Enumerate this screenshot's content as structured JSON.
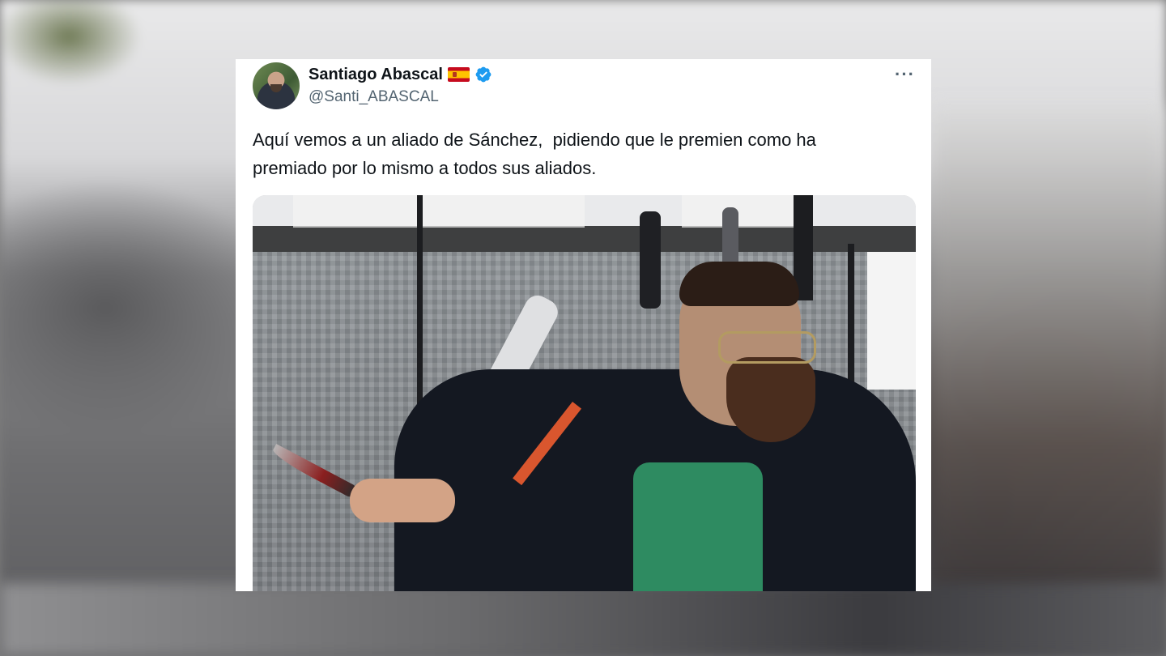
{
  "tweet": {
    "author_name": "Santiago Abascal",
    "flag_icon": "spain-flag-icon",
    "verified_icon": "verified-badge-icon",
    "handle": "@Santi_ABASCAL",
    "more_label": "···",
    "text": "Aquí vemos a un aliado de Sánchez,  pidiendo que le premien como ha\npremiado por lo mismo a todos sus aliados.",
    "media": {
      "type": "photo",
      "description_icon": "attached-photo"
    }
  },
  "colors": {
    "verified_blue": "#1d9bf0",
    "text_primary": "#0f1419",
    "text_secondary": "#536471"
  }
}
